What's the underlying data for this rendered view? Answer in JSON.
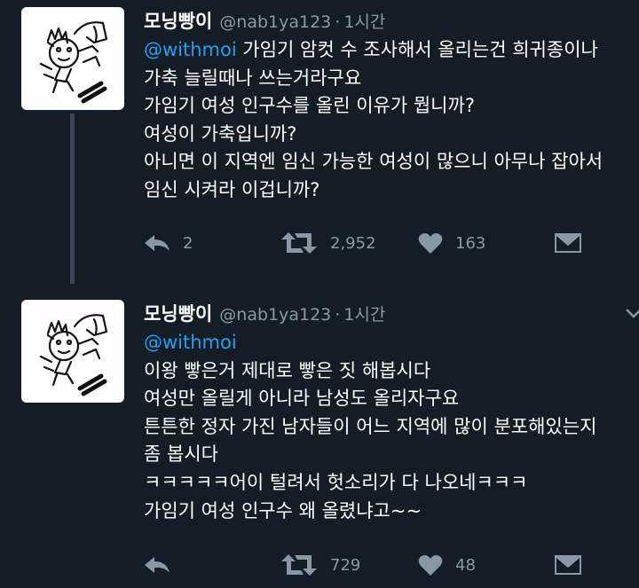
{
  "colors": {
    "background": "#141d26",
    "text": "#ffffff",
    "muted": "#8899a6",
    "link": "#1da1f2",
    "thread_line": "#3a4653"
  },
  "tweets": [
    {
      "display_name": "모닝빵이",
      "handle": "@nab1ya123",
      "separator": "·",
      "time": "1시간",
      "mention": "@withmoi",
      "first_line_text": " 가임기 암컷 수 조사해서 올리는건 희귀종이나",
      "lines": [
        "가축 늘릴때나 쓰는거라구요",
        "가임기 여성 인구수를 올린 이유가 뭡니까?",
        "여성이 가축입니까?",
        "아니면 이 지역엔 임신 가능한 여성이 많으니 아무나 잡아서",
        "임신 시켜라 이겁니까?"
      ],
      "reply_count": "2",
      "retweet_count": "2,952",
      "like_count": "163"
    },
    {
      "display_name": "모닝빵이",
      "handle": "@nab1ya123",
      "separator": "·",
      "time": "1시간",
      "mention": "@withmoi",
      "lines": [
        "이왕 빻은거 제대로 빻은 짓 해봅시다",
        "여성만 올릴게 아니라 남성도 올리자구요",
        "튼튼한 정자 가진 남자들이 어느 지역에 많이 분포해있는지",
        "좀 봅시다",
        "ㅋㅋㅋㅋㅋ어이 털려서 헛소리가 다 나오네ㅋㅋㅋ",
        "가임기 여성 인구수 왜 올렸냐고~~"
      ],
      "retweet_count": "729",
      "like_count": "48"
    }
  ]
}
